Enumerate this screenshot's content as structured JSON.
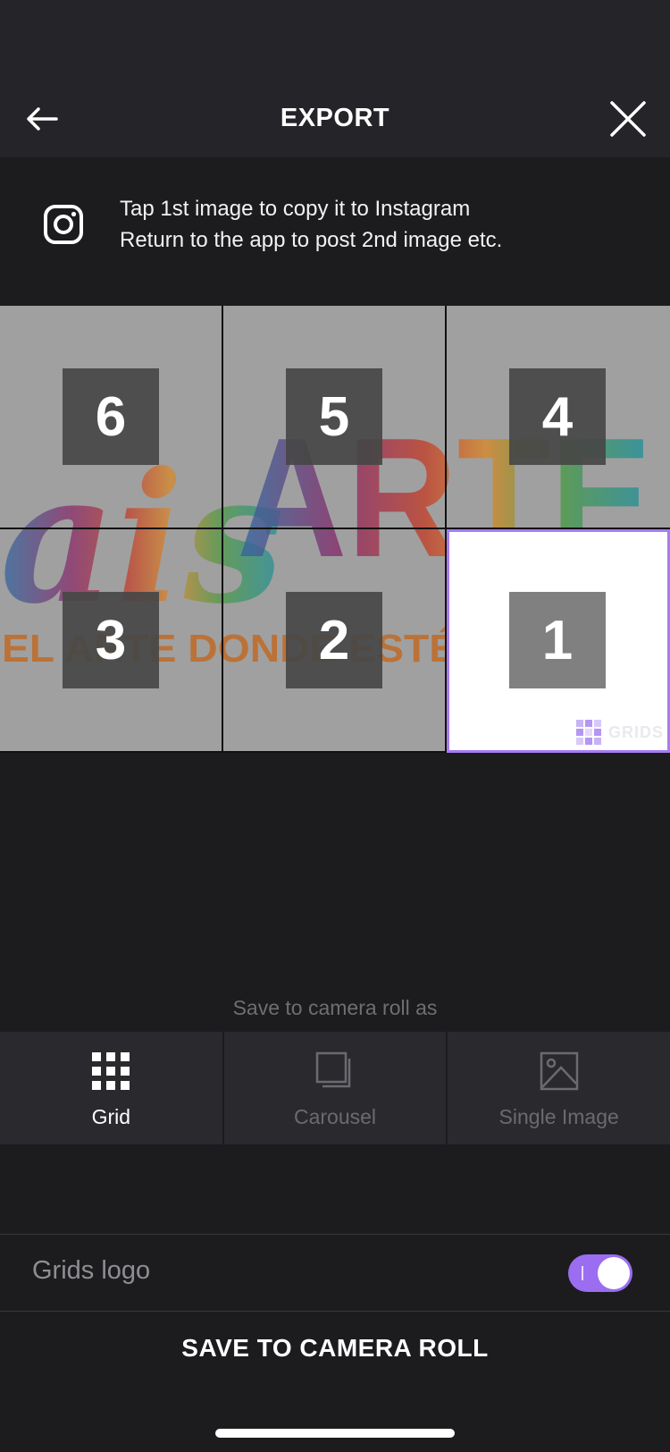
{
  "header": {
    "title": "EXPORT"
  },
  "info": {
    "line1": "Tap 1st image to copy it to Instagram",
    "line2": "Return to the app to post 2nd image etc."
  },
  "grid": {
    "cells": [
      "6",
      "5",
      "4",
      "3",
      "2",
      "1"
    ],
    "selected": "1",
    "watermark": "GRIDS",
    "artwork_text": "aislARTE",
    "artwork_tagline": "EL ARTE DONDE ESTÉS"
  },
  "save_as": {
    "label": "Save to camera roll as",
    "modes": [
      {
        "label": "Grid",
        "icon": "grid-icon",
        "active": true
      },
      {
        "label": "Carousel",
        "icon": "carousel-icon",
        "active": false
      },
      {
        "label": "Single Image",
        "icon": "image-icon",
        "active": false
      }
    ]
  },
  "logo_setting": {
    "label": "Grids logo",
    "enabled": true
  },
  "save_button": {
    "label": "SAVE TO CAMERA ROLL"
  },
  "colors": {
    "accent": "#9b6df0",
    "selected_border": "#a77cf2",
    "background": "#1c1c1e",
    "header": "#242429"
  }
}
